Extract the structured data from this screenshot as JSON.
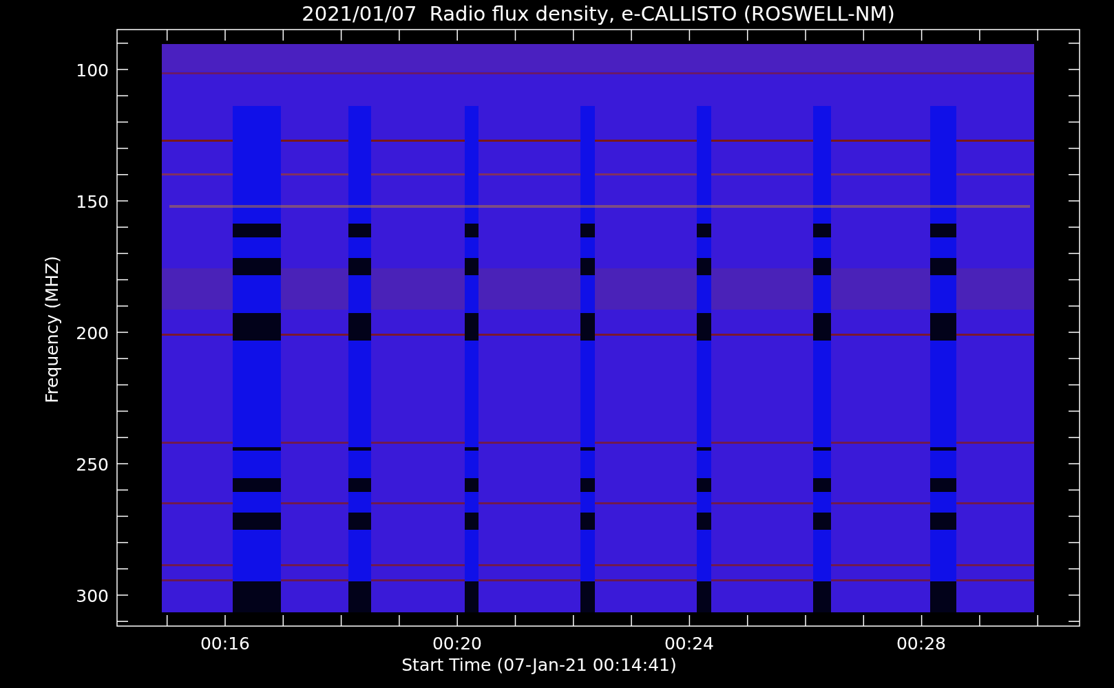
{
  "title": "2021/01/07  Radio flux density, e-CALLISTO (ROSWELL-NM)",
  "y_axis": {
    "label": "Frequency (MHZ)",
    "ticks": [
      "100",
      "150",
      "200",
      "250",
      "300"
    ]
  },
  "x_axis": {
    "label": "Start Time (07-Jan-21 00:14:41)",
    "ticks": [
      "00:16",
      "00:20",
      "00:24",
      "00:28"
    ]
  }
}
